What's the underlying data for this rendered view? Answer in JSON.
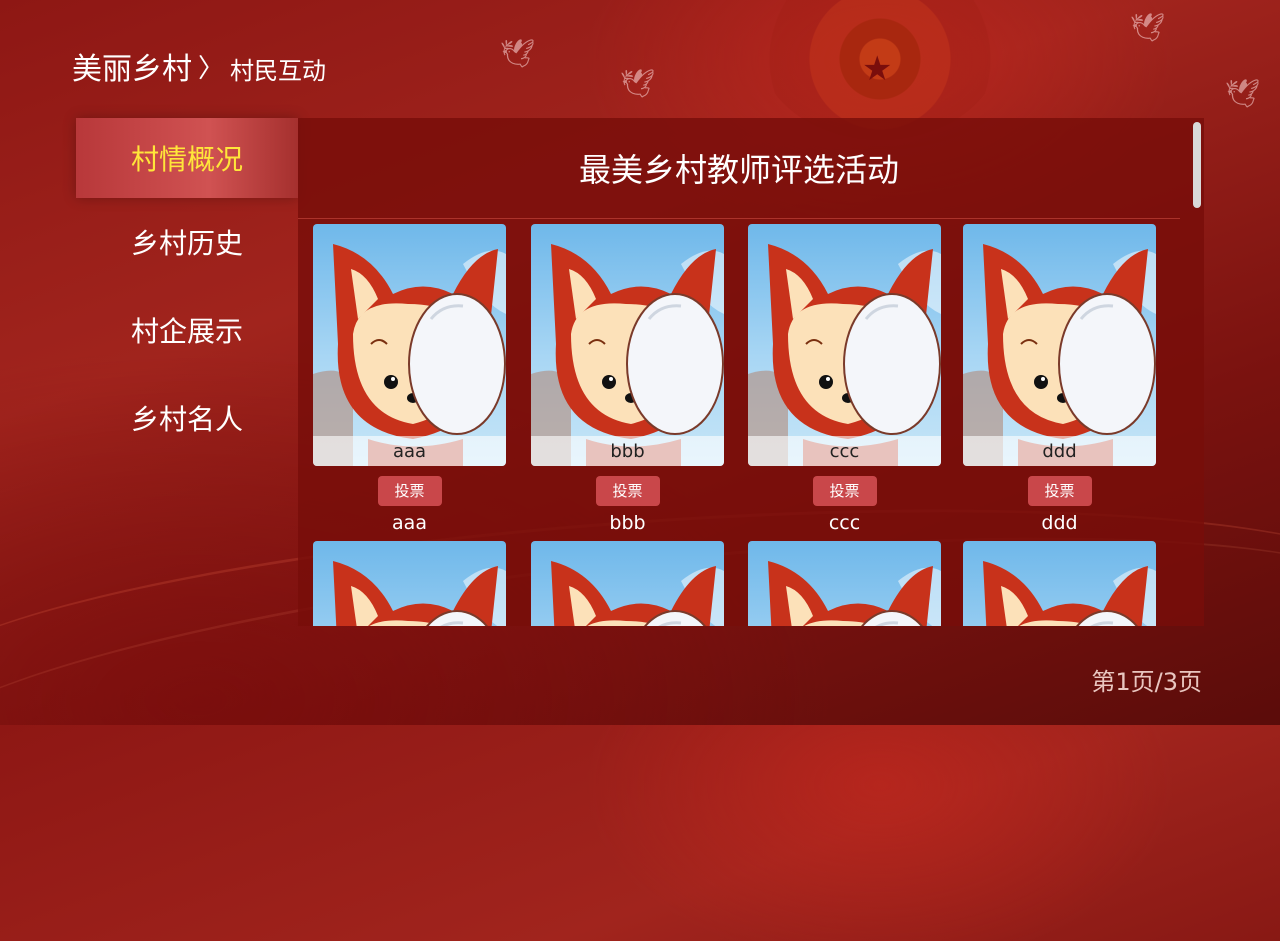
{
  "breadcrumb": {
    "main": "美丽乡村",
    "separator": "〉",
    "sub": "村民互动"
  },
  "sidebar": {
    "items": [
      {
        "label": "村情概况",
        "active": true
      },
      {
        "label": "乡村历史",
        "active": false
      },
      {
        "label": "村企展示",
        "active": false
      },
      {
        "label": "乡村名人",
        "active": false
      }
    ]
  },
  "main": {
    "title": "最美乡村教师评选活动",
    "vote_label": "投票",
    "candidates": [
      {
        "caption": "aaa",
        "name": "aaa"
      },
      {
        "caption": "bbb",
        "name": "bbb"
      },
      {
        "caption": "ccc",
        "name": "ccc"
      },
      {
        "caption": "ddd",
        "name": "ddd"
      },
      {
        "caption": "",
        "name": ""
      },
      {
        "caption": "",
        "name": ""
      },
      {
        "caption": "",
        "name": ""
      },
      {
        "caption": "",
        "name": ""
      }
    ]
  },
  "pager": {
    "text": "第1页/3页",
    "current_page": 1,
    "total_pages": 3
  },
  "colors": {
    "background": "#8e1714",
    "panel": "#780e0a",
    "active_item": "#c84a4b",
    "active_text": "#ffe63a",
    "vote_button": "#c9474a"
  }
}
